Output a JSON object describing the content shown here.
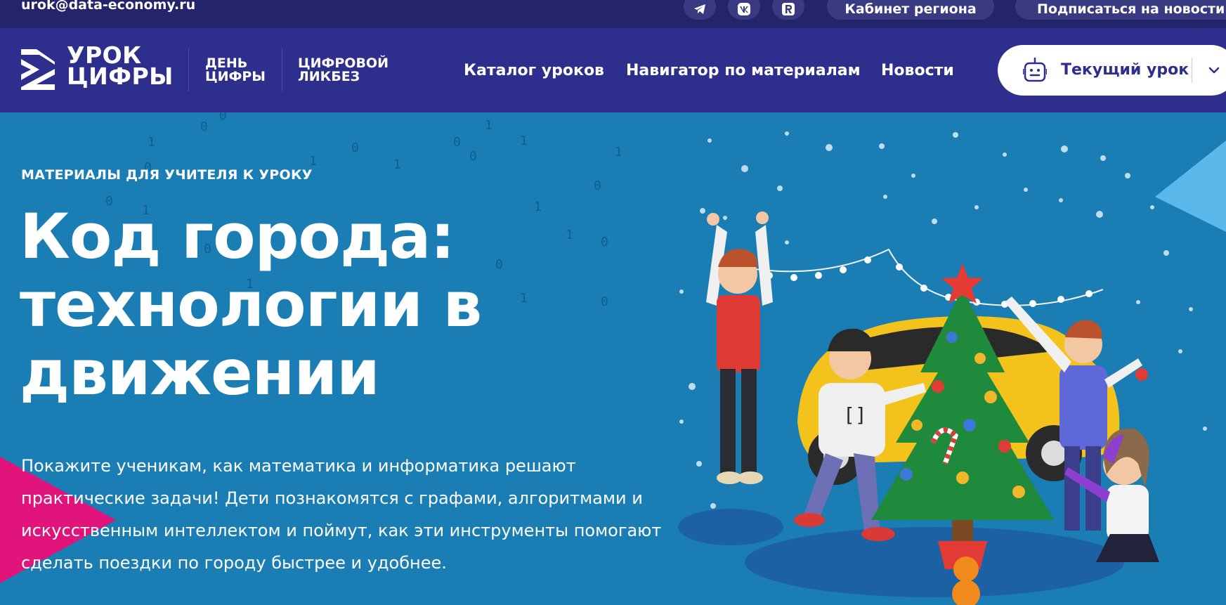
{
  "topbar": {
    "email": "urok@data-economy.ru",
    "social": [
      {
        "name": "telegram-icon"
      },
      {
        "name": "vk-icon"
      },
      {
        "name": "rutube-icon"
      }
    ],
    "region_label": "Кабинет региона",
    "subscribe_label": "Подписаться на новости"
  },
  "header": {
    "logo_line1": "УРОК",
    "logo_line2": "ЦИФРЫ",
    "brand2_line1": "ДЕНЬ",
    "brand2_line2": "ЦИФРЫ",
    "brand3_line1": "ЦИФРОВОЙ",
    "brand3_line2": "ЛИКБЕЗ",
    "nav": [
      "Каталог уроков",
      "Навигатор по материалам",
      "Новости"
    ],
    "current_lesson_label": "Текущий урок"
  },
  "hero": {
    "eyebrow": "МАТЕРИАЛЫ ДЛЯ УЧИТЕЛЯ К УРОКУ",
    "title": "Код города: технологии в движении",
    "description": "Покажите ученикам, как математика и информатика решают практические задачи! Дети познакомятся с графами, алгоритмами и искусственным интеллектом и поймут, как эти инструменты помогают сделать поездки по городу быстрее и удобнее."
  },
  "colors": {
    "topbar_bg": "#24246a",
    "header_bg": "#2e2f8d",
    "hero_bg": "#1a7db3",
    "accent_pink": "#e0147a",
    "accent_light_blue": "#5ab8ea"
  }
}
